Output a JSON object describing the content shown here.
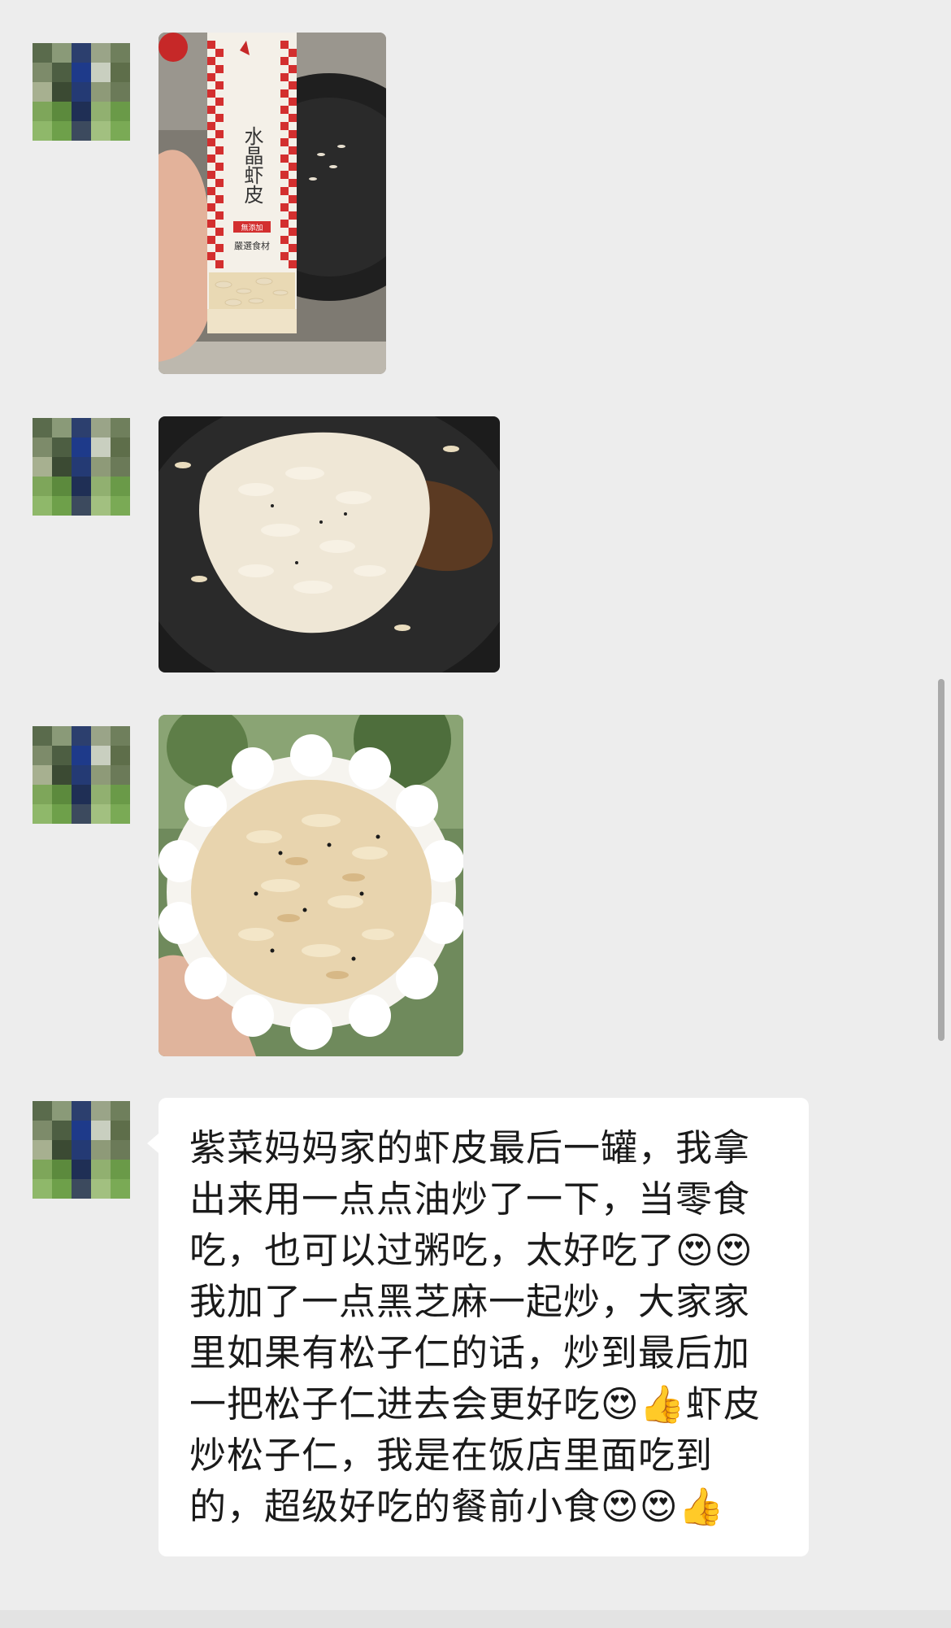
{
  "chat": {
    "messages": [
      {
        "type": "image",
        "image": "crystal-shrimp-skin-jar-photo",
        "jar_label": {
          "title": "水晶虾皮",
          "badge": "無添加",
          "tag": "嚴選食材"
        }
      },
      {
        "type": "image",
        "image": "shrimp-frying-in-wok-photo"
      },
      {
        "type": "image",
        "image": "shrimp-snack-in-bowl-photo"
      },
      {
        "type": "text",
        "text": "紫菜妈妈家的虾皮最后一罐，我拿出来用一点点油炒了一下，当零食吃，也可以过粥吃，太好吃了😍😍我加了一点黑芝麻一起炒，大家家里如果有松子仁的话，炒到最后加一把松子仁进去会更好吃😍👍虾皮炒松子仁，我是在饭店里面吃到的，超级好吃的餐前小食😍😍👍"
      }
    ]
  },
  "colors": {
    "background": "#ededed",
    "bubble": "#ffffff",
    "text": "#1a1a1a",
    "scrollbar": "#a9a9a9"
  }
}
